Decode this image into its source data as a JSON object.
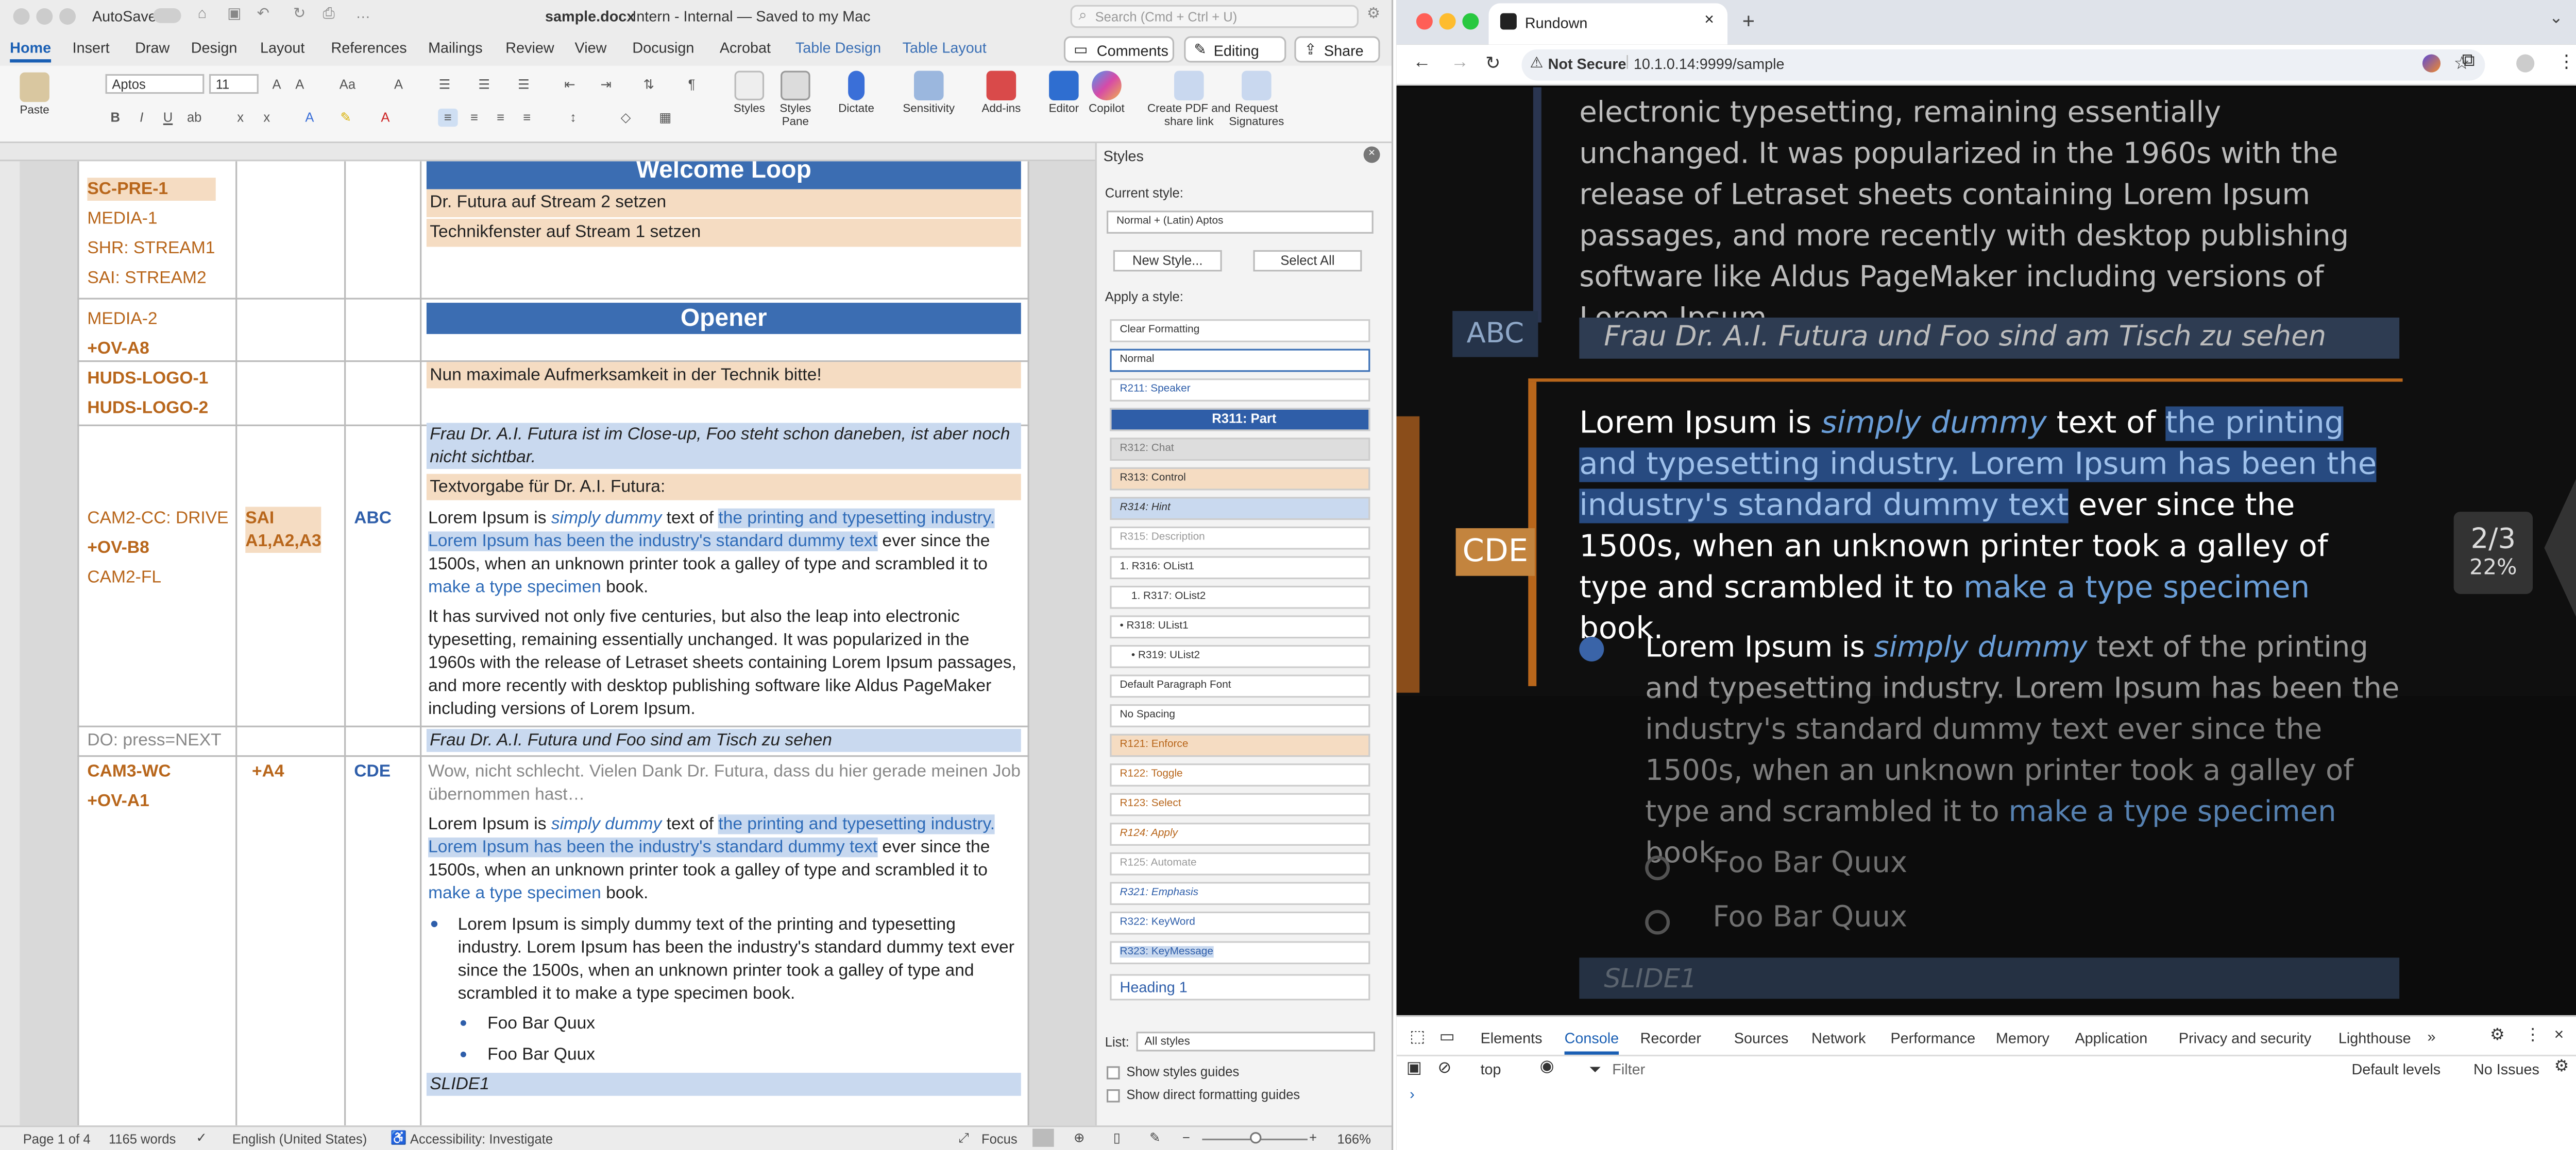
{
  "word": {
    "autosave_label": "AutoSave",
    "doc_title": "sample.docx",
    "label_status": "Intern - Internal — Saved to my Mac",
    "search_placeholder": "Search (Cmd + Ctrl + U)",
    "tabs": [
      "Home",
      "Insert",
      "Draw",
      "Design",
      "Layout",
      "References",
      "Mailings",
      "Review",
      "View",
      "Docusign",
      "Acrobat",
      "Table Design",
      "Table Layout"
    ],
    "comments_label": "Comments",
    "editing_label": "Editing",
    "share_label": "Share",
    "font_name": "Aptos",
    "font_size": "11",
    "ribbon": {
      "paste": "Paste",
      "styles": "Styles",
      "styles_pane": "Styles Pane",
      "dictate": "Dictate",
      "sensitivity": "Sensitivity",
      "addins": "Add-ins",
      "editor": "Editor",
      "copilot": "Copilot",
      "create_pdf": "Create PDF and share link",
      "request_sig": "Request Signatures"
    },
    "doc": {
      "r0c1": [
        "SC-PRE-1",
        "MEDIA-1",
        "SHR: STREAM1",
        "SAI: STREAM2"
      ],
      "r0c4_header": "Welcome Loop",
      "r0c4_lines": [
        "Dr. Futura auf Stream 2 setzen",
        "Technikfenster auf Stream 1 setzen"
      ],
      "r1c1": [
        "MEDIA-2",
        "+OV-A8"
      ],
      "r1c4_header": "Opener",
      "r2c1": [
        "HUDS-LOGO-1",
        "HUDS-LOGO-2"
      ],
      "r2c4": "Nun maximale Aufmerksamkeit in der Technik bitte!",
      "r3c4": "Frau Dr. A.I. Futura ist im Close-up, Foo steht schon daneben, ist aber noch nicht sichtbar.",
      "r4c4": "Textvorgabe für Dr. A.I. Futura:",
      "r5c1": [
        "CAM2-CC: DRIVE",
        "+OV-B8",
        "CAM2-FL"
      ],
      "r5c2": [
        "SAI",
        "A1,A2,A3"
      ],
      "r5c3": "ABC",
      "lorem_a": "Lorem Ipsum is",
      "lorem_b": "simply dummy",
      "lorem_c": "text of",
      "lorem_hl": "the printing and typesetting industry. Lorem Ipsum has been the industry's standard dummy text",
      "lorem_d": "ever since the 1500s, when an unknown printer took a galley of type and scrambled it to",
      "lorem_link": "make a type specimen",
      "lorem_e": "book.",
      "p2": "It has survived not only five centuries, but also the leap into electronic typesetting, remaining essentially unchanged. It was popularized in the 1960s with the release of Letraset sheets containing Lorem Ipsum passages, and more recently with desktop publishing software like Aldus PageMaker including versions of Lorem Ipsum.",
      "r6c1": "DO: press=NEXT",
      "r6c4": "Frau Dr. A.I. Futura und Foo sind am Tisch zu sehen",
      "r7c1": [
        "CAM3-WC",
        "+OV-A1"
      ],
      "r7c2": "+A4",
      "r7c3": "CDE",
      "r7c4_grey": "Wow, nicht schlecht. Vielen Dank Dr. Futura, dass du hier gerade meinen Job übernommen hast…",
      "bullet1": "Lorem Ipsum is simply dummy text of the printing and typesetting industry. Lorem Ipsum has been the industry's standard dummy text ever since the 1500s, when an unknown printer took a galley of type and scrambled it to make a type specimen book.",
      "sub1": "Foo Bar Quux",
      "sub2": "Foo Bar Quux",
      "slide": "SLIDE1"
    },
    "styles_pane": {
      "title": "Styles",
      "current_label": "Current style:",
      "current_value": "Normal + (Latin) Aptos",
      "new_style": "New Style...",
      "select_all": "Select All",
      "apply_label": "Apply a style:",
      "items": [
        "Clear Formatting",
        "Normal",
        "R211: Speaker",
        "R311: Part",
        "R312: Chat",
        "R313: Control",
        "R314: Hint",
        "R315: Description",
        "1.  R316: OList1",
        "1.  R317: OList2",
        "•  R318: UList1",
        "•  R319: UList2",
        "Default Paragraph Font",
        "No Spacing",
        "R121: Enforce",
        "R122: Toggle",
        "R123: Select",
        "R124: Apply",
        "R125: Automate",
        "R321: Emphasis",
        "R322: KeyWord",
        "R323: KeyMessage",
        "Heading 1"
      ],
      "list_label": "List:",
      "list_value": "All styles",
      "show_guides": "Show styles guides",
      "show_direct": "Show direct formatting guides"
    },
    "status": {
      "page": "Page 1 of 4",
      "words": "1165 words",
      "language": "English (United States)",
      "accessibility": "Accessibility: Investigate",
      "focus": "Focus",
      "zoom": "166%"
    }
  },
  "chrome": {
    "tab_title": "Rundown",
    "security": "Not Secure",
    "url": "10.1.0.14:9999/sample",
    "page": {
      "top_text": "electronic typesetting, remaining essentially unchanged. It was popularized in the 1960s with the release of Letraset sheets containing Lorem Ipsum passages, and more recently with desktop publishing software like Aldus PageMaker including versions of Lorem Ipsum.",
      "abc_tag": "ABC",
      "abc_text": "Frau Dr. A.I. Futura und Foo sind am Tisch zu sehen",
      "cde_tag": "CDE",
      "p1_a": "Lorem Ipsum is",
      "p1_b": "simply dummy",
      "p1_c": "text of",
      "p1_hl": "the printing and typesetting industry. Lorem Ipsum has been the industry's standard dummy text",
      "p1_d": "ever since the 1500s, when an unknown printer took a galley of type and scrambled it to",
      "p1_link": "make a type specimen",
      "p1_e": "book.",
      "bullet_a": "Lorem Ipsum is",
      "bullet_b": "simply dummy",
      "bullet_c": "text of the printing and typesetting industry. Lorem Ipsum has been the industry's standard dummy text ever since the 1500s, when an unknown printer took a galley of type and scrambled it to",
      "bullet_link": "make a type specimen",
      "bullet_e": "book.",
      "sub1": "Foo Bar Quux",
      "sub2": "Foo Bar Quux",
      "slide": "SLIDE1",
      "progress": "2/3",
      "percent": "22%"
    },
    "devtools": {
      "tabs": [
        "Elements",
        "Console",
        "Recorder",
        "Sources",
        "Network",
        "Performance",
        "Memory",
        "Application",
        "Privacy and security",
        "Lighthouse"
      ],
      "context": "top",
      "filter_placeholder": "Filter",
      "levels": "Default levels",
      "issues": "No Issues"
    }
  }
}
